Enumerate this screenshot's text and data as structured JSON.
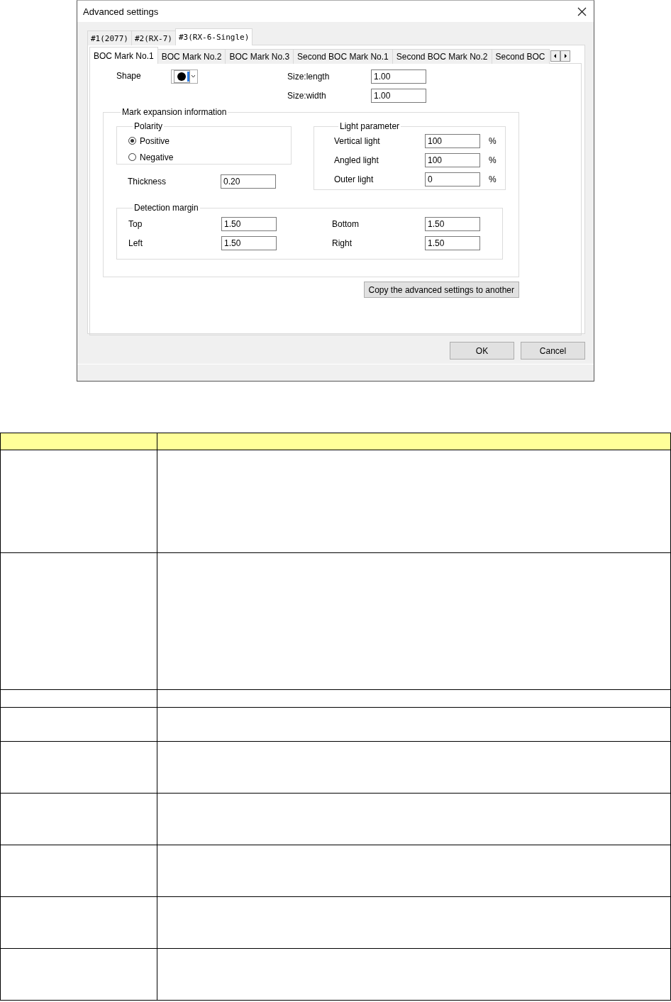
{
  "window": {
    "title": "Advanced settings"
  },
  "model_tabs": [
    {
      "label": "#1(2077)",
      "selected": false
    },
    {
      "label": "#2(RX-7)",
      "selected": false
    },
    {
      "label": "#3(RX-6-Single)",
      "selected": true
    }
  ],
  "mark_tabs": [
    {
      "label": "BOC Mark No.1",
      "selected": true
    },
    {
      "label": "BOC Mark No.2",
      "selected": false
    },
    {
      "label": "BOC Mark No.3",
      "selected": false
    },
    {
      "label": "Second BOC Mark No.1",
      "selected": false
    },
    {
      "label": "Second BOC Mark No.2",
      "selected": false
    },
    {
      "label": "Second BOC",
      "selected": false
    }
  ],
  "shape": {
    "label": "Shape"
  },
  "size_fields": [
    {
      "label": "Size:length",
      "value": "1.00"
    },
    {
      "label": "Size:width",
      "value": "1.00"
    }
  ],
  "mark_expansion": {
    "title": "Mark expansion information",
    "polarity": {
      "title": "Polarity",
      "options": [
        {
          "label": "Positive",
          "selected": true
        },
        {
          "label": "Negative",
          "selected": false
        }
      ]
    },
    "thickness": {
      "label": "Thickness",
      "value": "0.20"
    },
    "light": {
      "title": "Light parameter",
      "rows": [
        {
          "label": "Vertical light",
          "value": "100",
          "unit": "%"
        },
        {
          "label": "Angled light",
          "value": "100",
          "unit": "%"
        },
        {
          "label": "Outer light",
          "value": "0",
          "unit": "%"
        }
      ]
    },
    "detection": {
      "title": "Detection margin",
      "fields": [
        {
          "label": "Top",
          "value": "1.50"
        },
        {
          "label": "Bottom",
          "value": "1.50"
        },
        {
          "label": "Left",
          "value": "1.50"
        },
        {
          "label": "Right",
          "value": "1.50"
        }
      ]
    }
  },
  "copy_button": "Copy the advanced settings to another",
  "buttons": [
    "OK",
    "Cancel"
  ]
}
